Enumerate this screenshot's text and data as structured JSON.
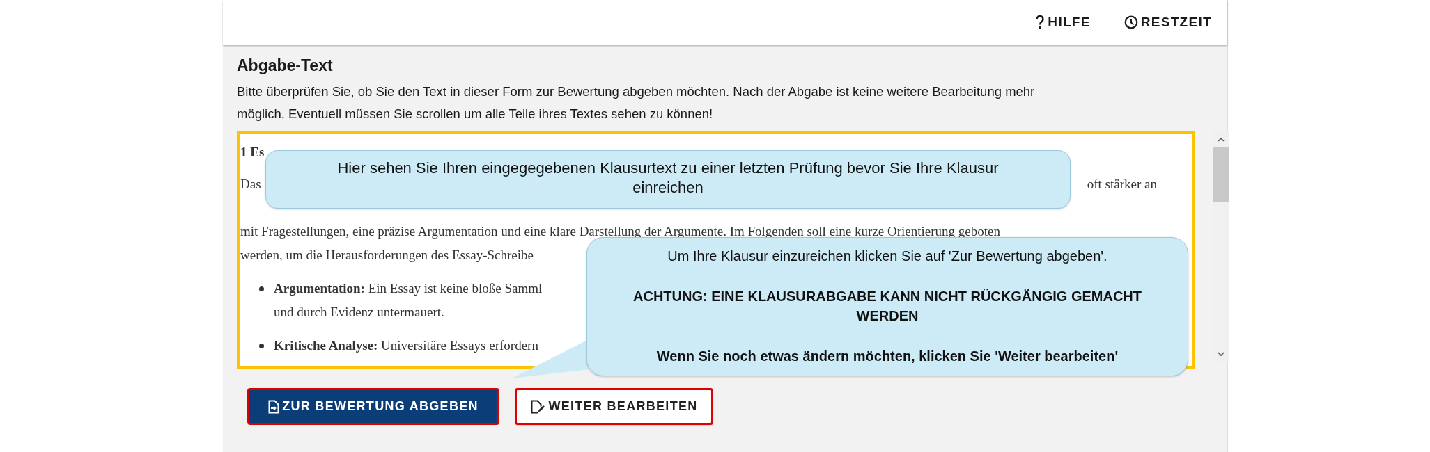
{
  "header": {
    "links": [
      {
        "kind": "help",
        "label": "HILFE"
      },
      {
        "kind": "timer",
        "label": "RESTZEIT"
      }
    ]
  },
  "panel": {
    "title": "Abgabe-Text",
    "description": "Bitte überprüfen Sie, ob Sie den Text in dieser Form zur Bewertung abgeben möchten. Nach der Abgabe ist keine weitere Bearbeitung mehr möglich. Eventuell müssen Sie scrollen um alle Teile ihres Textes sehen zu können!"
  },
  "essay": {
    "blocks": [
      {
        "kind": "heading",
        "text": "1 Es"
      },
      {
        "kind": "line",
        "text": "Das",
        "text_right": "oft stärker an"
      },
      {
        "kind": "line",
        "text": "mit Fragestellungen, eine präzise Argumentation und eine klare Darstellung der Argumente. Im Folgenden soll eine kurze Orientierung geboten"
      },
      {
        "kind": "line",
        "text": "werden, um die Herausforderungen des Essay-Schreibe"
      },
      {
        "kind": "bullet",
        "text": "**Argumentation:** Ein Essay ist keine bloße Samml"
      },
      {
        "kind": "continuation",
        "text": "und durch Evidenz untermauert."
      },
      {
        "kind": "bullet",
        "text": "**Kritische Analyse:** Universitäre Essays erfordern"
      }
    ]
  },
  "callouts": [
    {
      "kind": "top",
      "paragraphs": [
        {
          "text": "Hier sehen Sie Ihren eingegegebenen Klausurtext zu einer letzten Prüfung bevor Sie Ihre Klausur einreichen",
          "emphasis": false
        }
      ]
    },
    {
      "kind": "pointer",
      "paragraphs": [
        {
          "text": "Um Ihre Klausur einzureichen klicken Sie auf 'Zur Bewertung abgeben'.",
          "emphasis": false
        },
        {
          "text": "ACHTUNG: EINE KLAUSURABGABE KANN NICHT RÜCKGÄNGIG GEMACHT WERDEN",
          "emphasis": true
        },
        {
          "text": "Wenn Sie noch etwas ändern möchten, klicken Sie 'Weiter bearbeiten'",
          "emphasis": true
        }
      ]
    }
  ],
  "buttons": [
    {
      "kind": "primary",
      "label": "ZUR BEWERTUNG ABGEBEN",
      "highlighted": true
    },
    {
      "kind": "secondary",
      "label": "WEITER BEARBEITEN",
      "highlighted": true
    }
  ]
}
